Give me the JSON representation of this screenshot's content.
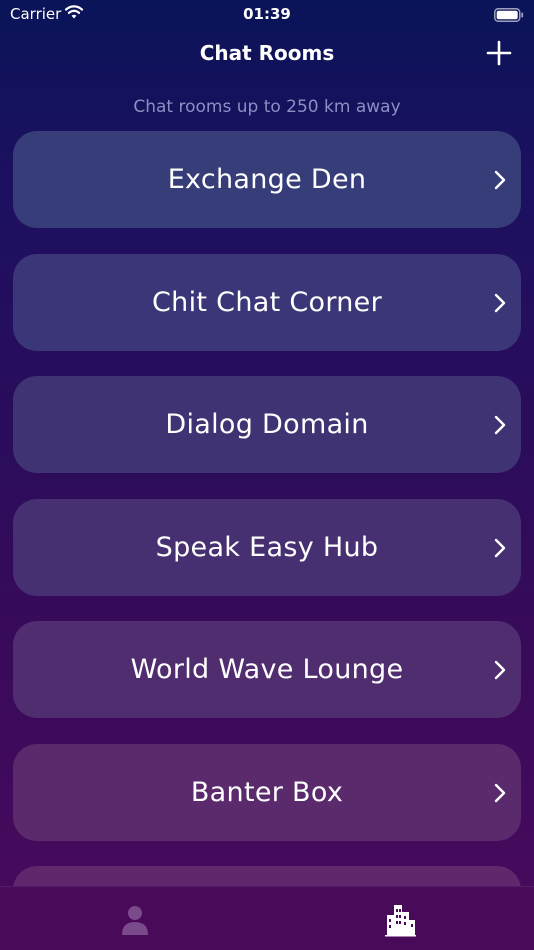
{
  "status": {
    "carrier": "Carrier",
    "time": "01:39"
  },
  "nav": {
    "title": "Chat Rooms",
    "add_icon": "plus-icon"
  },
  "subtitle": "Chat rooms up to 250 km away",
  "rooms": [
    {
      "name": "Exchange Den",
      "color": "#363d78"
    },
    {
      "name": "Chit Chat Corner",
      "color": "#3a3677"
    },
    {
      "name": "Dialog Domain",
      "color": "#3f3374"
    },
    {
      "name": "Speak Easy Hub",
      "color": "#463072"
    },
    {
      "name": "World Wave Lounge",
      "color": "#4f2d6f"
    },
    {
      "name": "Banter Box",
      "color": "#5a2a6d"
    },
    {
      "name": "",
      "color": "#61276c"
    }
  ],
  "tabs": [
    {
      "id": "profile",
      "icon": "person-icon",
      "active": false
    },
    {
      "id": "rooms",
      "icon": "city-icon",
      "active": true
    }
  ],
  "colors": {
    "tab_active": "#ffffff",
    "tab_inactive": "#7a4a8a",
    "subtitle": "#8b8fc4"
  }
}
